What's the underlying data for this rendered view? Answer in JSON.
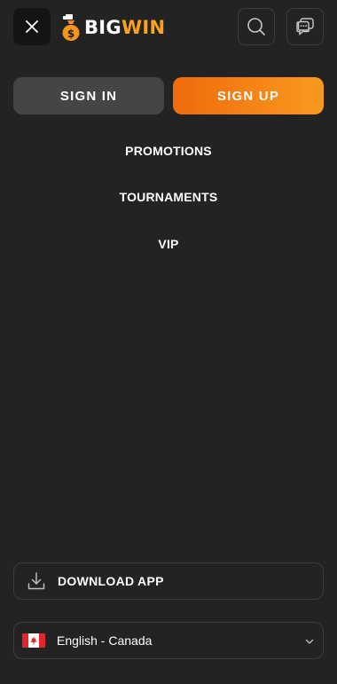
{
  "header": {
    "logo": {
      "big": "BIG",
      "win": "WIN"
    },
    "icons": {
      "close": "close-icon",
      "search": "search-icon",
      "chat": "chat-icon"
    }
  },
  "auth": {
    "sign_in": "SIGN IN",
    "sign_up": "SIGN UP"
  },
  "nav": {
    "items": [
      {
        "label": "PROMOTIONS"
      },
      {
        "label": "TOURNAMENTS"
      },
      {
        "label": "VIP"
      }
    ]
  },
  "footer": {
    "download_label": "DOWNLOAD APP",
    "language_label": "English - Canada"
  },
  "colors": {
    "background": "#232323",
    "accent_start": "#f06a0c",
    "accent_end": "#fa9a1f",
    "logo_win": "#fba21c"
  }
}
